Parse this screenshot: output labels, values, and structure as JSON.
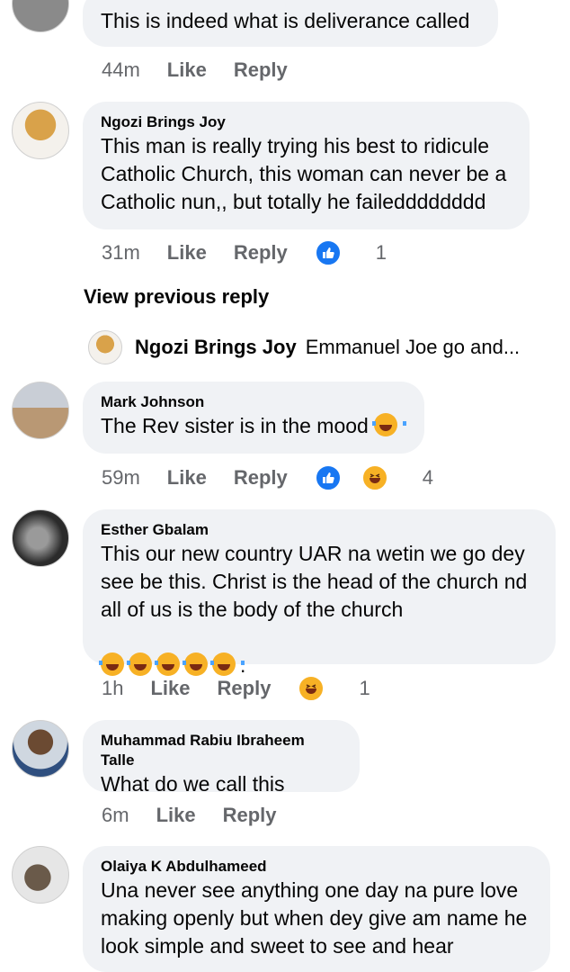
{
  "comments": [
    {
      "author": "",
      "text": "This is indeed what is deliverance called",
      "time": "44m",
      "like": "Like",
      "reply": "Reply",
      "reaction_count": ""
    },
    {
      "author": "Ngozi Brings Joy",
      "text": "This man is really trying his best to ridicule\nCatholic Church, this woman can never be a\nCatholic nun,, but totally he failedddddddd",
      "time": "31m",
      "like": "Like",
      "reply": "Reply",
      "reaction_count": "1",
      "reactions": [
        "like-icon"
      ]
    },
    {
      "author": "Mark Johnson",
      "text": "The Rev sister is in the mood",
      "time": "59m",
      "like": "Like",
      "reply": "Reply",
      "reaction_count": "4",
      "reactions": [
        "like-icon",
        "haha-icon"
      ]
    },
    {
      "author": "Esther Gbalam",
      "text": "This our new country UAR na wetin we go dey\nsee be this. Christ is the head of the church nd\nall of us is the body of the church",
      "text_tail": ".",
      "time": "1h",
      "like": "Like",
      "reply": "Reply",
      "reaction_count": "1",
      "reactions": [
        "haha-icon"
      ]
    },
    {
      "author": "Muhammad Rabiu Ibraheem Talle",
      "text": "What do we call this",
      "time": "6m",
      "like": "Like",
      "reply": "Reply",
      "reaction_count": ""
    },
    {
      "author": "Olaiya K Abdulhameed",
      "text": "Una never see anything one day na pure love\nmaking openly but when dey give am name he\nlook simple and sweet to see and hear",
      "time": "",
      "like": "",
      "reply": "",
      "reaction_count": ""
    }
  ],
  "thread": {
    "view_previous": "View previous reply",
    "reply_author": "Ngozi Brings Joy",
    "reply_snippet": "Emmanuel Joe go and..."
  },
  "colors": {
    "bubble": "#f0f2f5",
    "meta_text": "#65676b",
    "like_blue": "#1877f2",
    "haha_yellow": "#f7b125"
  }
}
